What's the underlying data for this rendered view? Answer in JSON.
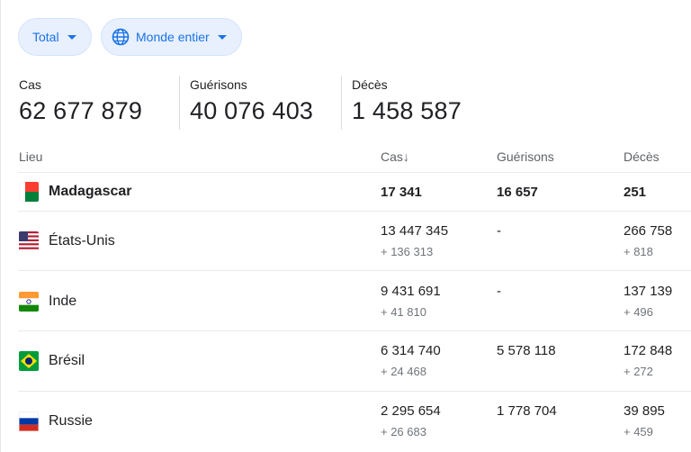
{
  "filters": {
    "total_label": "Total",
    "region_label": "Monde entier"
  },
  "summary": [
    {
      "label": "Cas",
      "value": "62 677 879"
    },
    {
      "label": "Guérisons",
      "value": "40 076 403"
    },
    {
      "label": "Décès",
      "value": "1 458 587"
    }
  ],
  "table": {
    "headers": {
      "place": "Lieu",
      "cases": "Cas",
      "sort_arrow": "↓",
      "recovered": "Guérisons",
      "deaths": "Décès"
    },
    "rows": [
      {
        "flag": "madagascar-flag",
        "name": "Madagascar",
        "cases": "17 341",
        "cases_delta": "",
        "recovered": "16 657",
        "deaths": "251",
        "deaths_delta": ""
      },
      {
        "flag": "usa-flag",
        "name": "États-Unis",
        "cases": "13 447 345",
        "cases_delta": "+ 136 313",
        "recovered": "-",
        "deaths": "266 758",
        "deaths_delta": "+ 818"
      },
      {
        "flag": "india-flag",
        "name": "Inde",
        "cases": "9 431 691",
        "cases_delta": "+ 41 810",
        "recovered": "-",
        "deaths": "137 139",
        "deaths_delta": "+ 496"
      },
      {
        "flag": "brazil-flag",
        "name": "Brésil",
        "cases": "6 314 740",
        "cases_delta": "+ 24 468",
        "recovered": "5 578 118",
        "deaths": "172 848",
        "deaths_delta": "+ 272"
      },
      {
        "flag": "russia-flag",
        "name": "Russie",
        "cases": "2 295 654",
        "cases_delta": "+ 26 683",
        "recovered": "1 778 704",
        "deaths": "39 895",
        "deaths_delta": "+ 459"
      }
    ]
  },
  "colors": {
    "accent": "#1a73e8",
    "chip_bg": "#e8f0fe",
    "muted": "#5f6368"
  }
}
